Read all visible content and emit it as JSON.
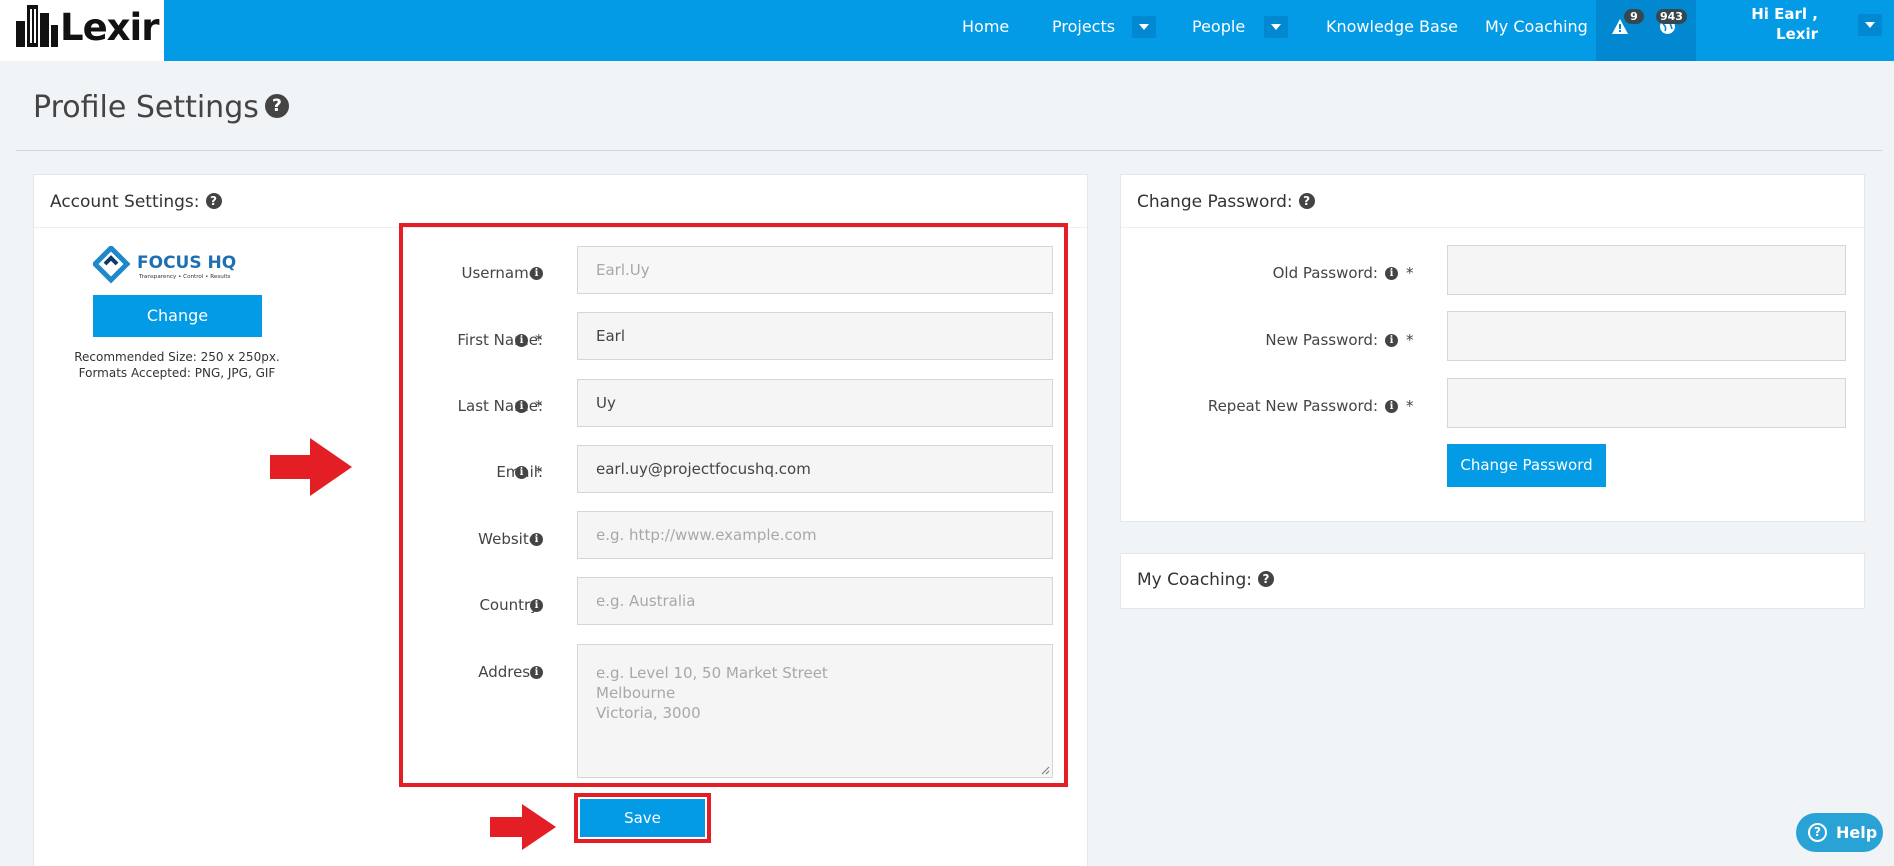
{
  "brand": {
    "name": "Lexir"
  },
  "nav": {
    "items": [
      {
        "label": "Home"
      },
      {
        "label": "Projects"
      },
      {
        "label": "People"
      },
      {
        "label": "Knowledge Base"
      },
      {
        "label": "My Coaching"
      }
    ],
    "alerts_count": "9",
    "notifications_count": "943",
    "user_line1": "Hi Earl ,",
    "user_line2": "Lexir"
  },
  "page": {
    "title": "Profile Settings",
    "help_glyph": "?"
  },
  "account": {
    "heading": "Account Settings:",
    "logo_brand": "FOCUS HQ",
    "logo_tagline": "Transparency • Control • Results",
    "change_button": "Change",
    "hint_size": "Recommended Size: 250 x 250px.",
    "hint_formats": "Formats Accepted: PNG, JPG, GIF",
    "fields": {
      "username": {
        "label": "Username:",
        "value": "Earl.Uy"
      },
      "first_name": {
        "label": "First Name:",
        "required": "*",
        "value": "Earl"
      },
      "last_name": {
        "label": "Last Name:",
        "required": "*",
        "value": "Uy"
      },
      "email": {
        "label": "Email:",
        "required": "*",
        "value": "earl.uy@projectfocushq.com"
      },
      "website": {
        "label": "Website:",
        "placeholder": "e.g. http://www.example.com"
      },
      "country": {
        "label": "Country:",
        "placeholder": "e.g. Australia"
      },
      "address": {
        "label": "Address:",
        "placeholder_line1": "e.g. Level 10, 50 Market Street",
        "placeholder_line2": "Melbourne",
        "placeholder_line3": "Victoria, 3000"
      }
    },
    "save_button": "Save",
    "info_glyph": "i"
  },
  "password": {
    "heading": "Change Password:",
    "old_label": "Old Password:",
    "new_label": "New Password:",
    "repeat_label": "Repeat New Password:",
    "required": "*",
    "button": "Change Password"
  },
  "coaching": {
    "heading": "My Coaching:"
  },
  "help": {
    "label": "Help"
  },
  "colors": {
    "primary": "#039be5",
    "highlight": "#e31e24",
    "nav_dark": "#0288d1"
  }
}
